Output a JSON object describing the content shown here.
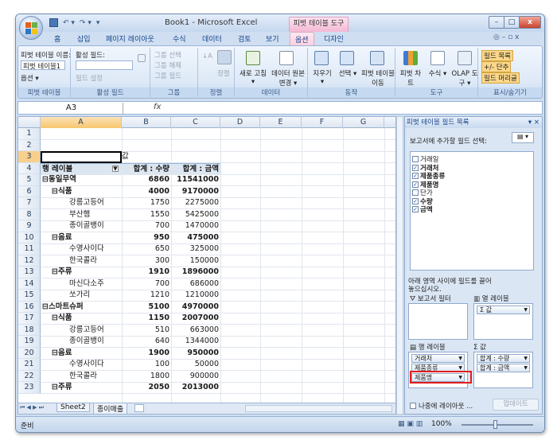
{
  "window": {
    "title": "Book1 - Microsoft Excel",
    "context_title": "피벗 테이블 도구",
    "controls": {
      "minimize": "–",
      "maximize": "□",
      "close": "x"
    }
  },
  "ribbon_tabs": [
    "홈",
    "삽입",
    "페이지 레이아웃",
    "수식",
    "데이터",
    "검토",
    "보기",
    "옵션",
    "디자인"
  ],
  "ribbon_tabs_right": "◎ – ▫ x",
  "ribbon": {
    "pivot_name_label": "피벗 테이블 이름:",
    "pivot_name_value": "피벗 테이블1",
    "options_btn": "옵션 ▾",
    "group_pivot": "피벗 테이블",
    "active_field_label": "활성 필드:",
    "field_settings": "필드 설정",
    "group_active": "활성 필드",
    "group_sel": "그룹 선택",
    "group_unsel": "그룹 해제",
    "group_field": "그룹 필드",
    "group_group": "그룹",
    "sort_label": "정렬",
    "group_sort": "정렬",
    "refresh_label": "새로 고침 ▾",
    "datasource_label": "데이터 원본 변경 ▾",
    "group_data": "데이터",
    "clear_label": "지우기 ▾",
    "select_label": "선택 ▾",
    "move_label": "피벗 테이블 이동",
    "group_action": "동작",
    "chart_label": "피벗 차트",
    "formula_label": "수식 ▾",
    "olap_label": "OLAP 도구 ▾",
    "group_tools": "도구",
    "field_list_btn": "필드 목록",
    "plusminus_btn": "+/- 단추",
    "field_header_btn": "필드 머리글",
    "group_show": "표시/숨기기"
  },
  "formula": {
    "namebox": "A3",
    "fx": "fx",
    "content": ""
  },
  "columns": [
    "A",
    "B",
    "C",
    "D",
    "E",
    "F",
    "G"
  ],
  "rows": [
    {
      "n": "1",
      "a": "",
      "b": "",
      "c": ""
    },
    {
      "n": "2",
      "a": "",
      "b": "",
      "c": ""
    },
    {
      "n": "3",
      "a": "",
      "b": "값",
      "c": ""
    },
    {
      "n": "4",
      "a": "행 레이블",
      "b": "합계 : 수량",
      "c": "합계 : 금액",
      "hdr": true
    },
    {
      "n": "5",
      "a": "⊟동일무역",
      "b": "6860",
      "c": "11541000",
      "bold": true,
      "lvl": 0
    },
    {
      "n": "6",
      "a": "⊟식품",
      "b": "4000",
      "c": "9170000",
      "bold": true,
      "lvl": 1
    },
    {
      "n": "7",
      "a": "강릉고등어",
      "b": "1750",
      "c": "2275000",
      "lvl": 2
    },
    {
      "n": "8",
      "a": "부산햄",
      "b": "1550",
      "c": "5425000",
      "lvl": 2
    },
    {
      "n": "9",
      "a": "종이골뱅이",
      "b": "700",
      "c": "1470000",
      "lvl": 2
    },
    {
      "n": "10",
      "a": "⊟음료",
      "b": "950",
      "c": "475000",
      "bold": true,
      "lvl": 1
    },
    {
      "n": "11",
      "a": "수영사이다",
      "b": "650",
      "c": "325000",
      "lvl": 2
    },
    {
      "n": "12",
      "a": "한국콜라",
      "b": "300",
      "c": "150000",
      "lvl": 2
    },
    {
      "n": "13",
      "a": "⊟주류",
      "b": "1910",
      "c": "1896000",
      "bold": true,
      "lvl": 1
    },
    {
      "n": "14",
      "a": "마신다소주",
      "b": "700",
      "c": "686000",
      "lvl": 2
    },
    {
      "n": "15",
      "a": "쏘가리",
      "b": "1210",
      "c": "1210000",
      "lvl": 2
    },
    {
      "n": "16",
      "a": "⊟스마트슈퍼",
      "b": "5100",
      "c": "4970000",
      "bold": true,
      "lvl": 0
    },
    {
      "n": "17",
      "a": "⊟식품",
      "b": "1150",
      "c": "2007000",
      "bold": true,
      "lvl": 1
    },
    {
      "n": "18",
      "a": "강릉고등어",
      "b": "510",
      "c": "663000",
      "lvl": 2
    },
    {
      "n": "19",
      "a": "종이골뱅이",
      "b": "640",
      "c": "1344000",
      "lvl": 2
    },
    {
      "n": "20",
      "a": "⊟음료",
      "b": "1900",
      "c": "950000",
      "bold": true,
      "lvl": 1
    },
    {
      "n": "21",
      "a": "수영사이다",
      "b": "100",
      "c": "50000",
      "lvl": 2
    },
    {
      "n": "22",
      "a": "한국콜라",
      "b": "1800",
      "c": "900000",
      "lvl": 2
    },
    {
      "n": "23",
      "a": "⊟주류",
      "b": "2050",
      "c": "2013000",
      "bold": true,
      "lvl": 1
    }
  ],
  "sheet_tabs": {
    "nav": "⏮ ◀ ▶ ⏭",
    "tab1": "Sheet2",
    "tab2": "종이매출"
  },
  "status": {
    "ready": "준비",
    "zoom": "100%"
  },
  "pane": {
    "title": "피벗 테이블 필드 목록",
    "choose_label": "보고서에 추가할 필드 선택:",
    "fields": [
      {
        "name": "거래일",
        "checked": false
      },
      {
        "name": "거래처",
        "checked": true
      },
      {
        "name": "제품종류",
        "checked": true
      },
      {
        "name": "제품명",
        "checked": true
      },
      {
        "name": "단가",
        "checked": false
      },
      {
        "name": "수량",
        "checked": true
      },
      {
        "name": "금액",
        "checked": true
      }
    ],
    "drag_hint_1": "아래 영역 사이에 필드를 끌어",
    "drag_hint_2": "놓으십시오.",
    "report_filter": "보고서 필터",
    "col_labels": "열 레이블",
    "row_labels": "행 레이블",
    "values": "값",
    "col_items": [
      "Σ 값"
    ],
    "row_items": [
      "거래처",
      "제품종류",
      "제품명"
    ],
    "value_items": [
      "합계 : 수량",
      "합계 : 금액"
    ],
    "defer_label": "나중에 레이아웃 ...",
    "update_btn": "업데이트"
  },
  "colors": {
    "highlight": "#e31c1c",
    "context_tab": "#f3b8d2"
  }
}
